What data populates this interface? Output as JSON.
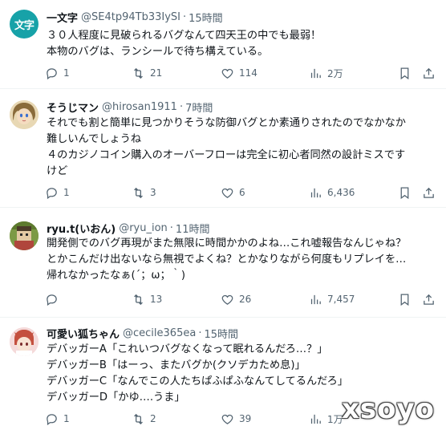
{
  "tweets": [
    {
      "avatar_text": "文字",
      "name": "一文字",
      "handle": "@SE4tp94Tb33IySI",
      "time": "15時間",
      "lines": [
        "３０人程度に見破られるバグなんて四天王の中でも最弱！",
        "本物のバグは、ランシールで待ち構えている。"
      ],
      "replies": "1",
      "retweets": "21",
      "likes": "114",
      "views": "2万"
    },
    {
      "name": "そうじマン",
      "handle": "@hirosan1911",
      "time": "7時間",
      "lines": [
        "それでも割と簡単に見つかりそうな防御バグとか素通りされたのでなかなか",
        "難しいんでしょうね",
        "４のカジノコイン購入のオーバーフローは完全に初心者同然の設計ミスです",
        "けど"
      ],
      "replies": "1",
      "retweets": "3",
      "likes": "6",
      "views": "6,436"
    },
    {
      "name": "ryu.t(いおん)",
      "handle": "@ryu_ion",
      "time": "11時間",
      "lines": [
        "開発側でのバグ再現がまた無限に時間かかのよね…これ嘘報告なんじゃね？",
        "とかこんだけ出ないなら無視でよくね？とかなりながら何度もリプレイを…",
        "帰れなかったなぁ(´；ω；｀)"
      ],
      "replies": "",
      "retweets": "13",
      "likes": "26",
      "views": "7,457"
    },
    {
      "name": "可愛い狐ちゃん",
      "handle": "@cecile365ea",
      "time": "15時間",
      "lines": [
        "デバッガーA「これいつバグなくなって眠れるんだろ…？」",
        "デバッガーB「はーっ、またバグか(クソデカため息)」",
        "デバッガーC「なんでこの人たちぱふぱふなんてしてるんだろ」",
        "デバッガーD「かゆ….うま」"
      ],
      "replies": "1",
      "retweets": "2",
      "likes": "39",
      "views": "1万"
    }
  ],
  "watermark": "xsoyo",
  "icons": {
    "reply": "reply-icon",
    "retweet": "retweet-icon",
    "like": "heart-icon",
    "views": "views-chart-icon",
    "bookmark": "bookmark-icon",
    "share": "share-icon"
  }
}
